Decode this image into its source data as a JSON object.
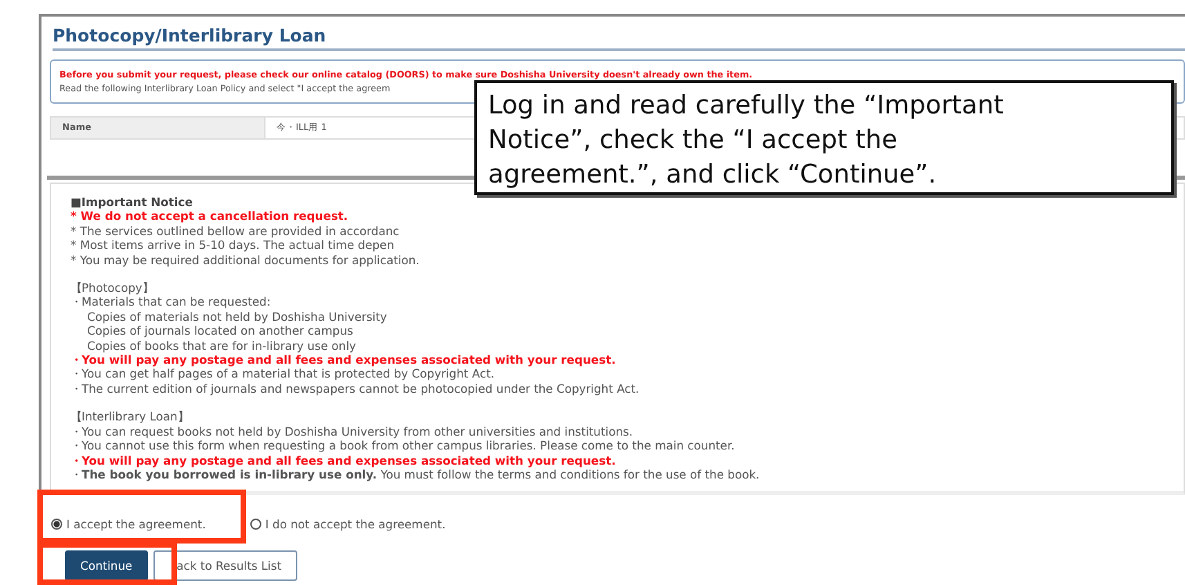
{
  "page_title": "Photocopy/Interlibrary Loan",
  "warning": {
    "alert": "Before you submit your request, please check our online catalog (DOORS) to make sure Doshisha University doesn't already own the item.",
    "instruction": "Read the following Interlibrary Loan Policy and select \"I accept the agreem"
  },
  "name_row": {
    "label": "Name",
    "value": "今・ILL用 1"
  },
  "notice": [
    {
      "kind": "heading",
      "text": "■Important Notice"
    },
    {
      "kind": "alert",
      "text": "* We do not accept a cancellation request."
    },
    {
      "kind": "plain",
      "text": "* The services outlined bellow are provided in accordanc"
    },
    {
      "kind": "plain",
      "text": "* Most items arrive in 5-10 days. The actual time depen"
    },
    {
      "kind": "plain",
      "text": "* You may be required additional documents for application."
    },
    {
      "kind": "section",
      "text": "【Photocopy】"
    },
    {
      "kind": "plain",
      "text": "・Materials that can be requested:"
    },
    {
      "kind": "indent",
      "text": "Copies of materials not held by Doshisha University"
    },
    {
      "kind": "indent",
      "text": "Copies of journals located on another campus"
    },
    {
      "kind": "indent",
      "text": "Copies of books that are for in-library use only"
    },
    {
      "kind": "alert",
      "text": "・You will pay any postage and all fees and expenses associated with your request."
    },
    {
      "kind": "plain",
      "text": "・You can get half pages of a material that is protected by Copyright Act."
    },
    {
      "kind": "plain",
      "text": "・The current edition of journals and newspapers cannot be photocopied under the Copyright Act."
    },
    {
      "kind": "section",
      "text": "【Interlibrary Loan】"
    },
    {
      "kind": "plain",
      "text": "・You can request books not held by Doshisha University from other universities and institutions."
    },
    {
      "kind": "plain",
      "text": "・You cannot use this form when requesting a book from other campus libraries. Please come to the main counter."
    },
    {
      "kind": "alert",
      "text": "・You will pay any postage and all fees and expenses associated with your request."
    },
    {
      "kind": "plain",
      "text": "・**The book you borrowed is in-library use only.** You must follow the terms and conditions for the use of the book."
    }
  ],
  "agreement": [
    {
      "label": "I accept the agreement.",
      "selected": true
    },
    {
      "label": "I do not accept the agreement.",
      "selected": false
    }
  ],
  "buttons": [
    {
      "kind": "primary",
      "label": "Continue"
    },
    {
      "kind": "secondary",
      "label": "ack to Results List"
    }
  ],
  "callout": [
    "Log in and read carefully the “Important",
    "Notice”, check the “I accept the",
    "agreement.”, and click “Continue”."
  ]
}
